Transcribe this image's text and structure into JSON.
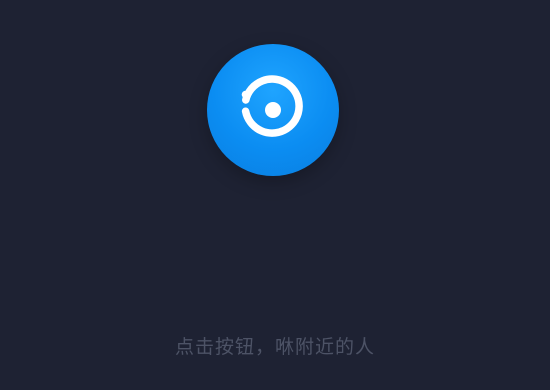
{
  "hint": {
    "text": "点击按钮，咻附近的人"
  },
  "colors": {
    "background": "#1e2233",
    "button": "#0b8df2",
    "hint_text": "#4d5366",
    "icon": "#ffffff"
  },
  "icons": {
    "main_button_icon": "radar-target-icon"
  }
}
